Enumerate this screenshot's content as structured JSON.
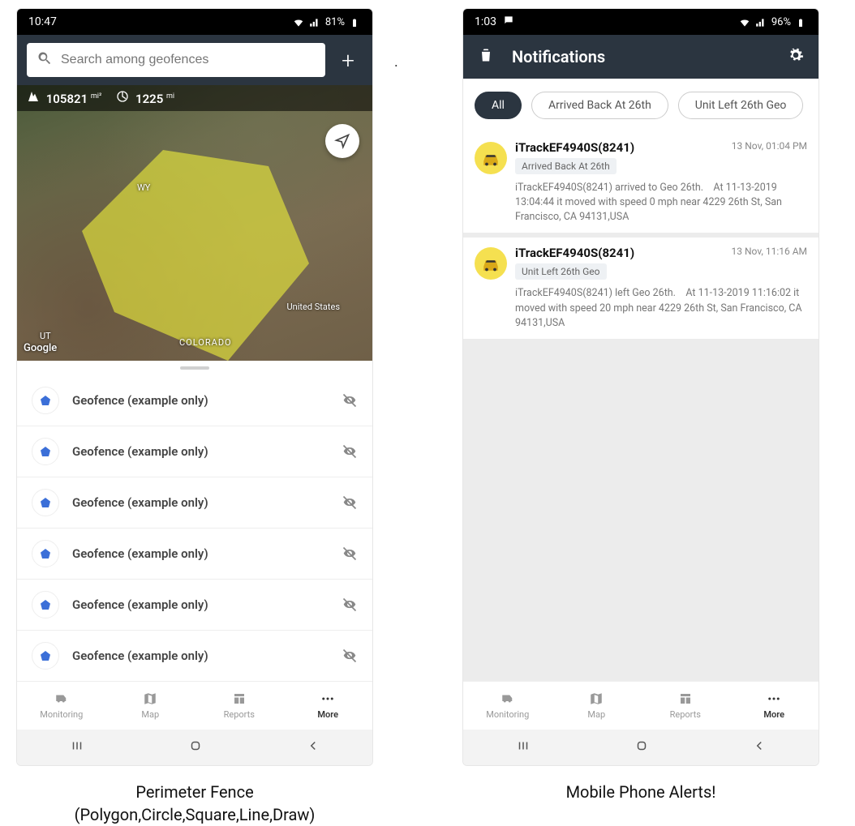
{
  "phone1": {
    "statusbar": {
      "time": "10:47",
      "battery": "81%"
    },
    "search": {
      "placeholder": "Search among geofences"
    },
    "stats": {
      "area": "105821",
      "area_unit": "mi²",
      "perimeter": "1225",
      "perimeter_unit": "mi"
    },
    "map_labels": {
      "wy": "WY",
      "ut": "UT",
      "colorado": "COLORADO",
      "us": "United States",
      "google": "Google"
    },
    "list_item_label": "Geofence (example only)",
    "nav": {
      "monitoring": "Monitoring",
      "map": "Map",
      "reports": "Reports",
      "more": "More"
    },
    "caption_line1": "Perimeter Fence",
    "caption_line2": "(Polygon,Circle,Square,Line,Draw)"
  },
  "phone2": {
    "statusbar": {
      "time": "1:03",
      "battery": "96%"
    },
    "header": {
      "title": "Notifications"
    },
    "chips": {
      "all": "All",
      "arrived": "Arrived Back At 26th",
      "left": "Unit Left 26th Geo"
    },
    "items": [
      {
        "title": "iTrackEF4940S(8241)",
        "time": "13 Nov, 01:04 PM",
        "tag": "Arrived Back At 26th",
        "body": "iTrackEF4940S(8241) arrived to Geo 26th.    At 11-13-2019 13:04:44 it moved with speed 0 mph near 4229 26th St, San Francisco, CA 94131,USA"
      },
      {
        "title": "iTrackEF4940S(8241)",
        "time": "13 Nov, 11:16 AM",
        "tag": "Unit Left 26th Geo",
        "body": "iTrackEF4940S(8241) left Geo 26th.    At 11-13-2019 11:16:02 it moved with speed 20 mph near 4229 26th St, San Francisco, CA 94131,USA"
      }
    ],
    "nav": {
      "monitoring": "Monitoring",
      "map": "Map",
      "reports": "Reports",
      "more": "More"
    },
    "caption": "Mobile Phone Alerts!"
  }
}
